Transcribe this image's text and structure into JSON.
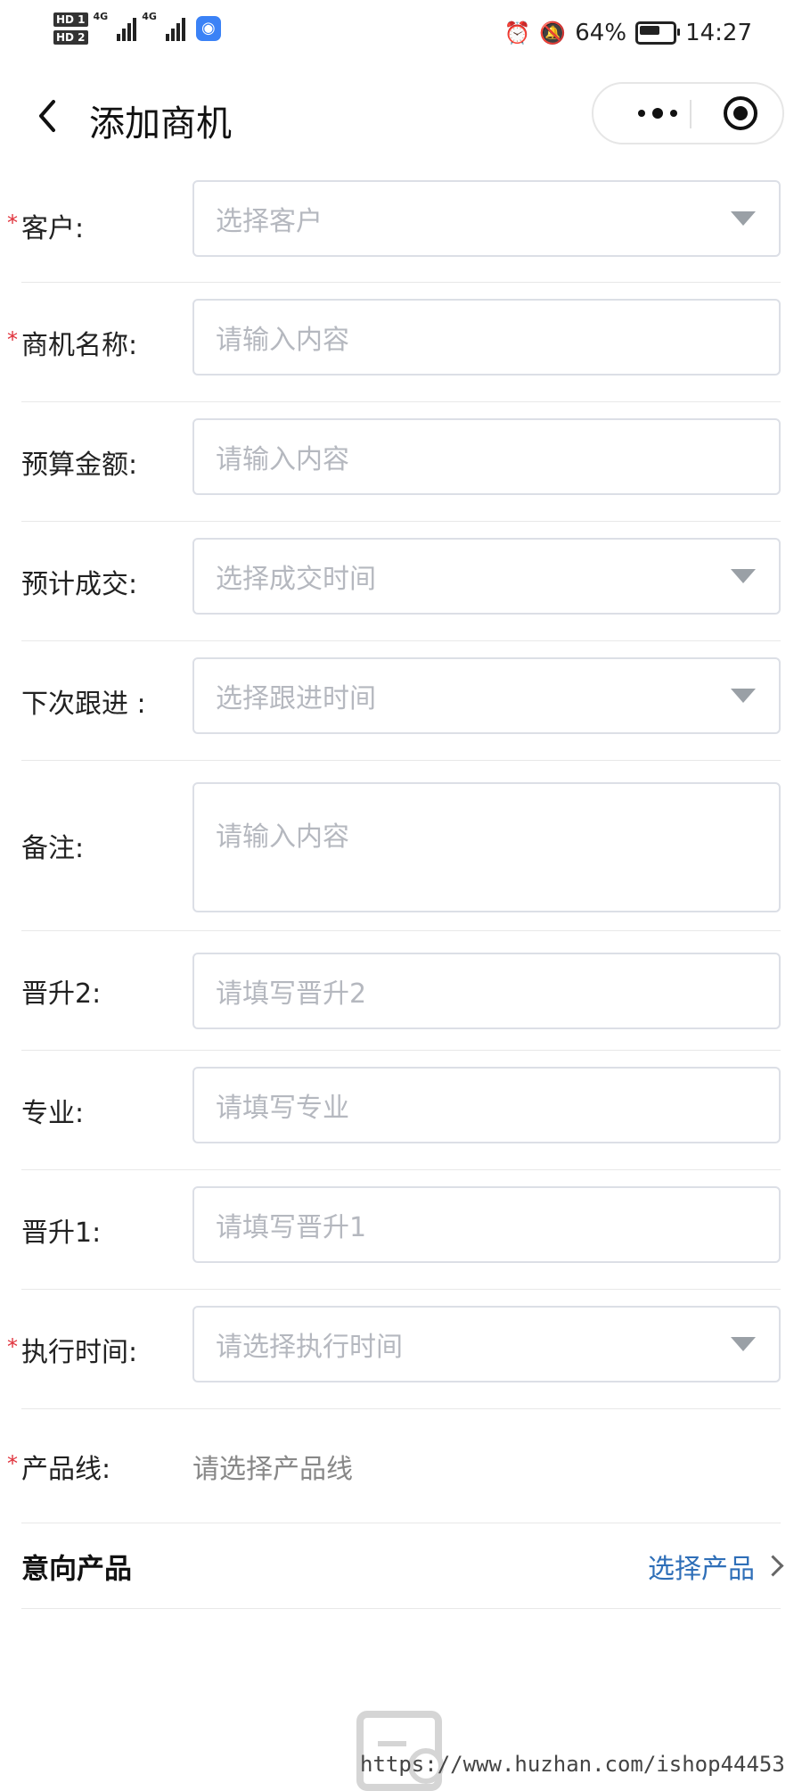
{
  "status_bar": {
    "hd1": "HD 1",
    "hd2": "HD 2",
    "net1": "4G",
    "net2": "4G",
    "battery": "64%",
    "time": "14:27",
    "icons": [
      "alarm-icon",
      "mute-bell-icon",
      "battery-icon"
    ]
  },
  "nav": {
    "title": "添加商机"
  },
  "form": {
    "customer": {
      "label": "客户:",
      "placeholder": "选择客户",
      "required": true
    },
    "opportunity_name": {
      "label": "商机名称:",
      "placeholder": "请输入内容",
      "required": true
    },
    "budget": {
      "label": "预算金额:",
      "placeholder": "请输入内容",
      "required": false
    },
    "expected_deal": {
      "label": "预计成交:",
      "placeholder": "选择成交时间",
      "required": false
    },
    "next_followup": {
      "label": "下次跟进 :",
      "placeholder": "选择跟进时间",
      "required": false
    },
    "remark": {
      "label": "备注:",
      "placeholder": "请输入内容",
      "required": false
    },
    "promotion2": {
      "label": "晋升2:",
      "placeholder": "请填写晋升2",
      "required": false
    },
    "major": {
      "label": "专业:",
      "placeholder": "请填写专业",
      "required": false
    },
    "promotion1": {
      "label": "晋升1:",
      "placeholder": "请填写晋升1",
      "required": false
    },
    "exec_time": {
      "label": "执行时间:",
      "placeholder": "请选择执行时间",
      "required": true
    },
    "product_line": {
      "label": "产品线:",
      "value": "请选择产品线",
      "required": true
    },
    "intent_product": {
      "label": "意向产品",
      "link": "选择产品"
    }
  },
  "watermark": "https://www.huzhan.com/ishop44453",
  "required_mark": "*"
}
